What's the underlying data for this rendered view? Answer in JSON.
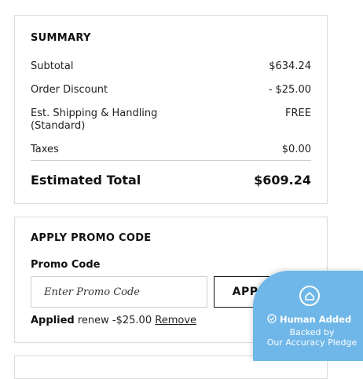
{
  "summary": {
    "heading": "SUMMARY",
    "rows": [
      {
        "label": "Subtotal",
        "value": "$634.24"
      },
      {
        "label": "Order Discount",
        "value": "- $25.00"
      },
      {
        "label": "Est. Shipping & Handling (Standard)",
        "value": "FREE"
      },
      {
        "label": "Taxes",
        "value": "$0.00"
      }
    ],
    "total_label": "Estimated Total",
    "total_value": "$609.24"
  },
  "promo": {
    "heading": "APPLY PROMO CODE",
    "field_label": "Promo Code",
    "input_placeholder": "Enter Promo Code",
    "apply_label": "APPLY",
    "applied_prefix": "Applied",
    "applied_detail": "renew -$25.00",
    "remove_label": "Remove"
  },
  "badge": {
    "title": "Human Added",
    "line1": "Backed by",
    "line2": "Our Accuracy Pledge",
    "color": "#6fb7e8"
  }
}
